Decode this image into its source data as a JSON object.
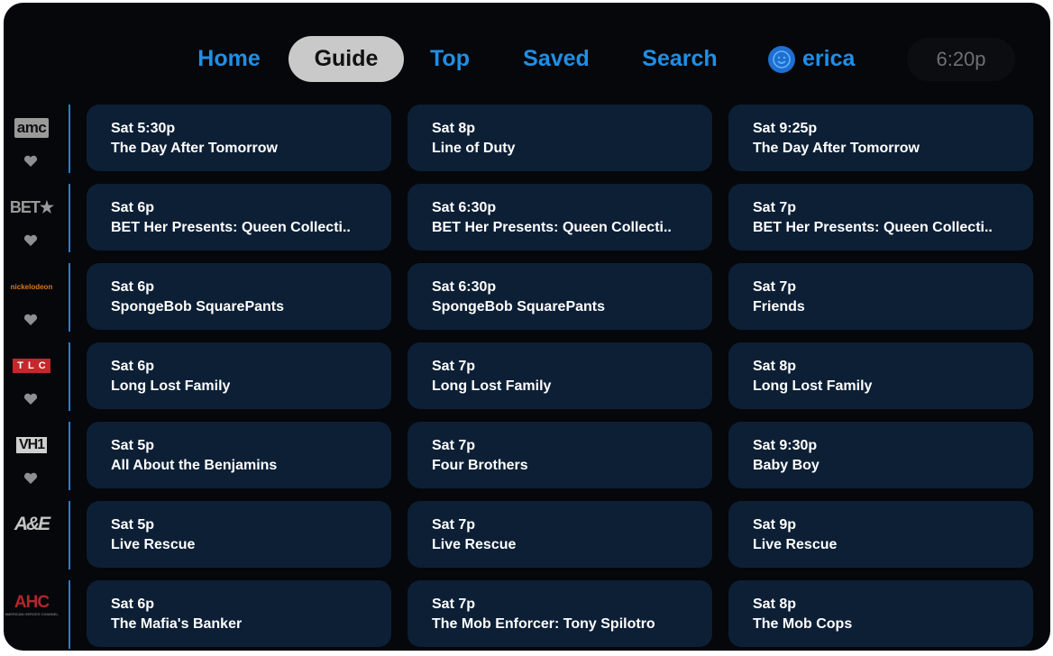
{
  "nav": {
    "items": [
      {
        "label": "Home"
      },
      {
        "label": "Guide",
        "active": true
      },
      {
        "label": "Top"
      },
      {
        "label": "Saved"
      },
      {
        "label": "Search"
      }
    ],
    "user": {
      "name": "erica"
    },
    "clock": "6:20p"
  },
  "colors": {
    "background": "#05070b",
    "accent": "#1f8fe6",
    "card": "#0c1f35",
    "active_tab": "#c9c9c9"
  },
  "channels": [
    {
      "logo": "amc",
      "icon": "amc-logo",
      "programs": [
        {
          "time": "Sat 5:30p",
          "title": "The Day After Tomorrow"
        },
        {
          "time": "Sat 8p",
          "title": "Line of Duty"
        },
        {
          "time": "Sat 9:25p",
          "title": "The Day After Tomorrow"
        }
      ]
    },
    {
      "logo": "BET★",
      "icon": "bet-logo",
      "programs": [
        {
          "time": "Sat 6p",
          "title": "BET Her Presents: Queen Collecti.."
        },
        {
          "time": "Sat 6:30p",
          "title": "BET Her Presents: Queen Collecti.."
        },
        {
          "time": "Sat 7p",
          "title": "BET Her Presents: Queen Collecti.."
        }
      ]
    },
    {
      "logo": "nickelodeon",
      "icon": "nickelodeon-logo",
      "programs": [
        {
          "time": "Sat 6p",
          "title": "SpongeBob SquarePants"
        },
        {
          "time": "Sat 6:30p",
          "title": "SpongeBob SquarePants"
        },
        {
          "time": "Sat 7p",
          "title": "Friends"
        }
      ]
    },
    {
      "logo": "TLC",
      "icon": "tlc-logo",
      "programs": [
        {
          "time": "Sat 6p",
          "title": "Long Lost Family"
        },
        {
          "time": "Sat 7p",
          "title": "Long Lost Family"
        },
        {
          "time": "Sat 8p",
          "title": "Long Lost Family"
        }
      ]
    },
    {
      "logo": "VH1",
      "icon": "vh1-logo",
      "programs": [
        {
          "time": "Sat 5p",
          "title": "All About the Benjamins"
        },
        {
          "time": "Sat 7p",
          "title": "Four Brothers"
        },
        {
          "time": "Sat 9:30p",
          "title": "Baby Boy"
        }
      ]
    },
    {
      "logo": "A&E",
      "icon": "ae-logo",
      "programs": [
        {
          "time": "Sat 5p",
          "title": "Live Rescue"
        },
        {
          "time": "Sat 7p",
          "title": "Live Rescue"
        },
        {
          "time": "Sat 9p",
          "title": "Live Rescue"
        }
      ]
    },
    {
      "logo": "AHC",
      "logo_sub": "AMERICAN HEROES CHANNEL",
      "icon": "ahc-logo",
      "programs": [
        {
          "time": "Sat 6p",
          "title": "The Mafia's Banker"
        },
        {
          "time": "Sat 7p",
          "title": "The Mob Enforcer: Tony Spilotro"
        },
        {
          "time": "Sat 8p",
          "title": "The Mob Cops"
        }
      ]
    }
  ]
}
